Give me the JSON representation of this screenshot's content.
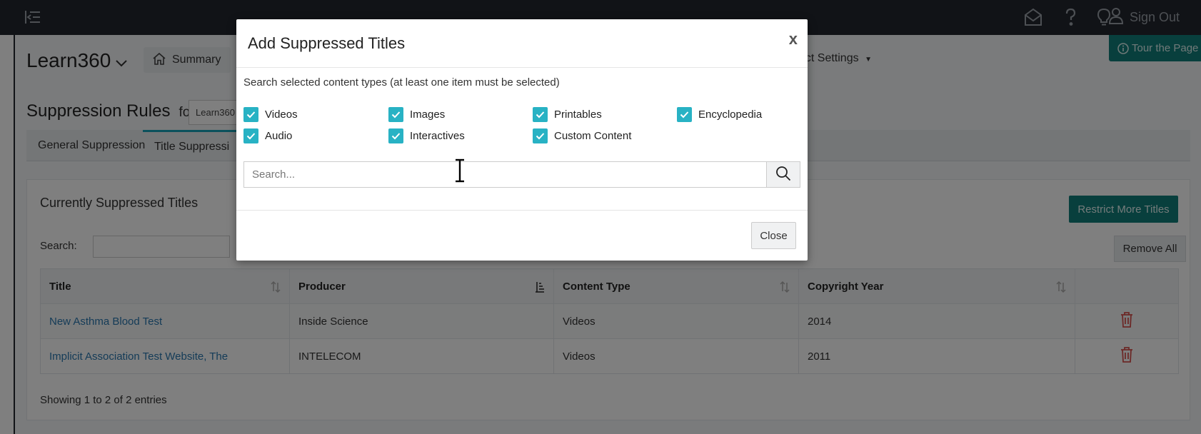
{
  "topbar": {
    "signout_label": "Sign Out",
    "icons": [
      "menu-toggle-icon",
      "mail-icon",
      "help-icon",
      "lightbulb-icon",
      "user-icon"
    ]
  },
  "page": {
    "tour_label": "Tour the Page",
    "product_title": "Learn360",
    "summary_label": "Summary",
    "product_settings_label": "uct Settings",
    "rules_heading": "Suppression Rules",
    "rules_for": "for",
    "scope_value": "Learn360",
    "tabs": [
      {
        "label": "General Suppression",
        "active": false
      },
      {
        "label": "Title Suppressi",
        "active": true
      }
    ],
    "card_title": "Currently Suppressed Titles",
    "restrict_label": "Restrict More Titles",
    "search_label": "Search:",
    "remove_all_label": "Remove All",
    "table": {
      "columns": [
        "Title",
        "Producer",
        "Content Type",
        "Copyright Year",
        ""
      ],
      "rows": [
        {
          "title": "New Asthma Blood Test",
          "producer": "Inside Science",
          "content_type": "Videos",
          "year": "2014"
        },
        {
          "title": "Implicit Association Test Website, The",
          "producer": "INTELECOM",
          "content_type": "Videos",
          "year": "2011"
        }
      ]
    },
    "showing": "Showing 1 to 2 of 2 entries"
  },
  "modal": {
    "title": "Add Suppressed Titles",
    "close_x": "x",
    "instruction": "Search selected content types (at least one item must be selected)",
    "content_types": [
      {
        "label": "Videos",
        "checked": true
      },
      {
        "label": "Images",
        "checked": true
      },
      {
        "label": "Printables",
        "checked": true
      },
      {
        "label": "Encyclopedia",
        "checked": true
      },
      {
        "label": "Audio",
        "checked": true
      },
      {
        "label": "Interactives",
        "checked": true
      },
      {
        "label": "Custom Content",
        "checked": true
      }
    ],
    "search_placeholder": "Search...",
    "search_value": "",
    "close_label": "Close"
  },
  "colors": {
    "topbar": "#23272e",
    "accent_teal": "#117e7b",
    "checkbox": "#28b2c4",
    "link": "#2a78b0",
    "trash": "#d9534f"
  }
}
